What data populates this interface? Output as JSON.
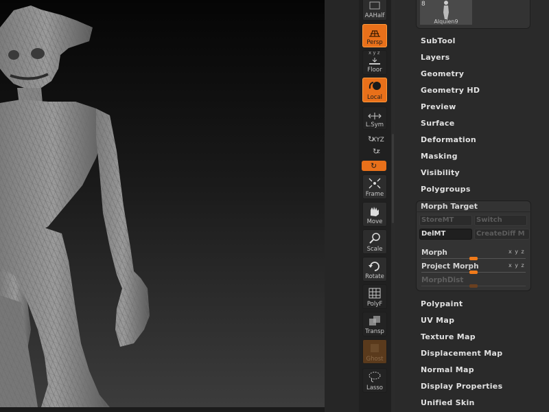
{
  "shelf": {
    "aahalf": "AAHalf",
    "persp": "Persp",
    "floor": "Floor",
    "floor_axes": "x y z",
    "local": "Local",
    "lsym": "L.Sym",
    "xyz": "XYZ",
    "z_label": "Z",
    "frame": "Frame",
    "move": "Move",
    "scale": "Scale",
    "rotate": "Rotate",
    "polyf": "PolyF",
    "transp": "Transp",
    "ghost": "Ghost",
    "lasso": "Lasso"
  },
  "tool_thumb": {
    "count": "8",
    "name": "Alquien9"
  },
  "menus_top": [
    "SubTool",
    "Layers",
    "Geometry",
    "Geometry HD",
    "Preview",
    "Surface",
    "Deformation",
    "Masking",
    "Visibility",
    "Polygroups"
  ],
  "morph": {
    "title": "Morph Target",
    "store": "StoreMT",
    "switch": "Switch",
    "del": "DelMT",
    "creatediff": "CreateDiff M",
    "morph_label": "Morph",
    "project_label": "Project Morph",
    "dist_label": "MorphDist",
    "axes": "x y z",
    "morph_value": 0.5,
    "project_value": 0.5,
    "dist_value": 0.5
  },
  "menus_bottom": [
    "Polypaint",
    "UV Map",
    "Texture Map",
    "Displacement Map",
    "Normal Map",
    "Display Properties",
    "Unified Skin"
  ],
  "colors": {
    "accent": "#e8701a",
    "panel_bg": "#2a2a2a",
    "menu_text": "#e2e2e2"
  }
}
